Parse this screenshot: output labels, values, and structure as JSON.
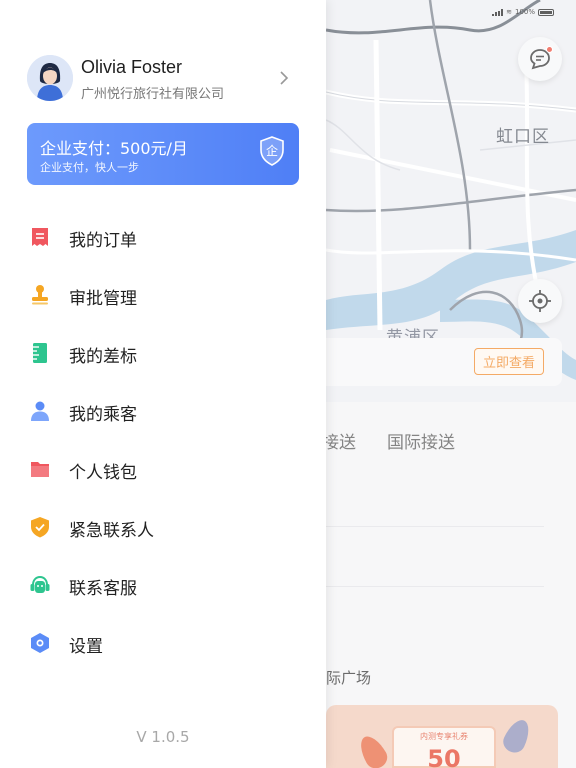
{
  "status_bar": {
    "battery": "100%"
  },
  "map": {
    "district_labels": [
      "虹口区",
      "黄浦区"
    ]
  },
  "promo": {
    "view_now_label": "立即查看"
  },
  "service_tabs": {
    "transfer_label": "接送",
    "international_label": "国际接送"
  },
  "plaza_label": "际广场",
  "coupon": {
    "title": "内测专享礼券",
    "amount": "50"
  },
  "user": {
    "name": "Olivia Foster",
    "company": "广州悦行旅行社有限公司"
  },
  "enterprise_pay": {
    "title": "企业支付：500元/月",
    "subtitle": "企业支付，快人一步",
    "badge": "企"
  },
  "menu": {
    "items": [
      {
        "label": "我的订单",
        "icon": "receipt-icon",
        "color": "#f0575f"
      },
      {
        "label": "审批管理",
        "icon": "stamp-icon",
        "color": "#f5a623"
      },
      {
        "label": "我的差标",
        "icon": "ruler-icon",
        "color": "#2ec58f"
      },
      {
        "label": "我的乘客",
        "icon": "passenger-icon",
        "color": "#5b8cf7"
      },
      {
        "label": "个人钱包",
        "icon": "wallet-icon",
        "color": "#f0575f"
      },
      {
        "label": "紧急联系人",
        "icon": "shield-check-icon",
        "color": "#f5a623"
      },
      {
        "label": "联系客服",
        "icon": "customer-service-icon",
        "color": "#2ec58f"
      },
      {
        "label": "设置",
        "icon": "settings-hexagon-icon",
        "color": "#5b8cf7"
      }
    ]
  },
  "version": "V 1.0.5",
  "colors": {
    "accent_blue": "#5b8cf7",
    "accent_orange": "#f08a2b",
    "river": "#a9cbe4"
  }
}
